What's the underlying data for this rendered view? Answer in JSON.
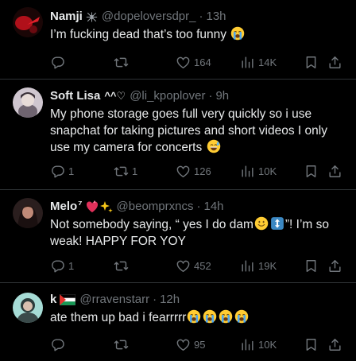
{
  "tweets": [
    {
      "name": "Namji",
      "handle": "@dopeloversdpr_",
      "time": "13h",
      "text": "I’m fucking dead that’s too funny",
      "reply_count": "",
      "retweet_count": "",
      "like_count": "164",
      "view_count": "14K",
      "avatar_colors": [
        "#2a0a0a",
        "#c0141a"
      ],
      "name_decoration": "spider-icon"
    },
    {
      "name": "Soft Lisa",
      "name_suffix": "^^♡",
      "handle": "@li_kpoplover",
      "time": "9h",
      "text": "My phone storage goes full very quickly so i use snapchat for taking pictures and short videos I only use my camera for concerts",
      "reply_count": "1",
      "retweet_count": "1",
      "like_count": "126",
      "view_count": "10K",
      "avatar_colors": [
        "#d9d0d8",
        "#8b7d86"
      ]
    },
    {
      "name": "Melo",
      "name_suffix": "⁷",
      "handle": "@beomprxncs",
      "time": "14h",
      "text_before": "Not somebody saying, “ yes I do dam",
      "text_after": "”! I’m so weak! HAPPY FOR YOY",
      "reply_count": "1",
      "retweet_count": "",
      "like_count": "452",
      "view_count": "19K",
      "avatar_colors": [
        "#3a2a2a",
        "#b07a6a"
      ],
      "name_decoration": "heart-sparkle-icons"
    },
    {
      "name": "k",
      "handle": "@rravenstarr",
      "time": "12h",
      "text": "ate them up bad i fearrrrr",
      "reply_count": "",
      "retweet_count": "",
      "like_count": "95",
      "view_count": "10K",
      "avatar_colors": [
        "#9fd7d2",
        "#2a3a3a"
      ],
      "name_decoration": "palestine-flag-icon"
    }
  ],
  "colors": {
    "background": "#000000",
    "text": "#e7e9ea",
    "muted": "#71767b",
    "divider": "#2f3336"
  }
}
